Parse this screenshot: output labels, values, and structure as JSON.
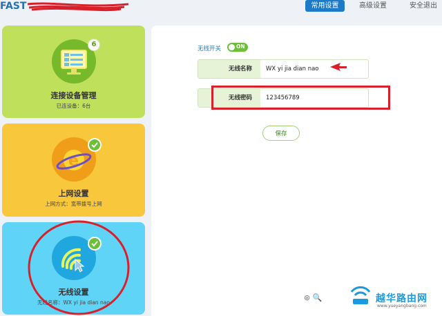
{
  "header": {
    "nav": [
      {
        "label": "常用设置",
        "active": true
      },
      {
        "label": "高级设置",
        "active": false
      },
      {
        "label": "安全退出",
        "active": false
      }
    ]
  },
  "cards": {
    "devices": {
      "title": "连接设备管理",
      "subtitle": "已连设备：6台",
      "badge": "6",
      "icon": "monitor-icon"
    },
    "internet": {
      "title": "上网设置",
      "subtitle": "上网方式：宽带拨号上网",
      "icon": "globe-e-icon"
    },
    "wireless": {
      "title": "无线设置",
      "subtitle": "无线名称：WX yi jia dian nao",
      "icon": "wifi-signal-icon"
    }
  },
  "wireless_form": {
    "switch_label": "无线开关",
    "switch_state": "ON",
    "ssid_label": "无线名称",
    "ssid_value": "WX yi jia dian nao",
    "password_label": "无线密码",
    "password_value": "123456789",
    "save_label": "保存"
  },
  "watermark": {
    "brand": "越华路由网",
    "url": "www.yueyangbang.com"
  },
  "colors": {
    "accent": "#1c7ac8",
    "green_card": "#bfe05b",
    "orange_card": "#f8c73c",
    "blue_card": "#5fd4f7",
    "annotation_red": "#d8202a",
    "toggle_on": "#6dbf3a"
  }
}
